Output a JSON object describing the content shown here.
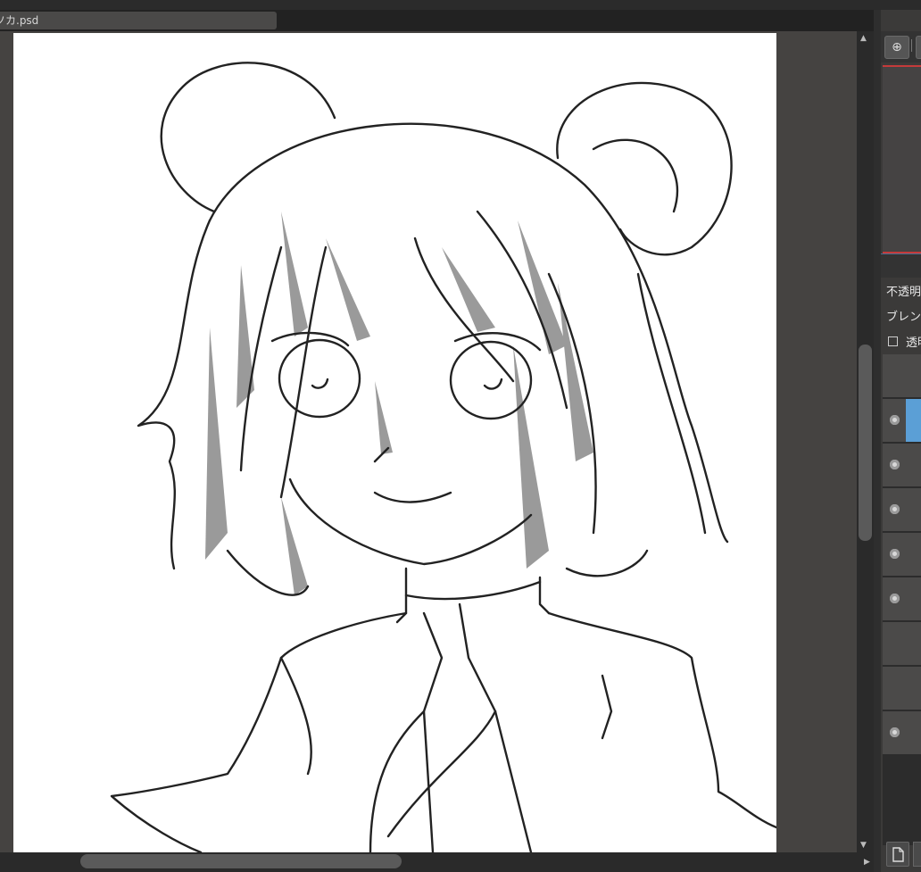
{
  "document": {
    "tab_title": "ソカ.psd"
  },
  "navigator": {
    "zoom_icon": "zoom-in-icon"
  },
  "layer_panel": {
    "opacity_label": "不透明",
    "blend_label": "ブレンド",
    "protect_alpha_label": "透明",
    "layers": [
      {
        "visible": false,
        "selected": false
      },
      {
        "visible": true,
        "selected": true
      },
      {
        "visible": true,
        "selected": false
      },
      {
        "visible": true,
        "selected": false
      },
      {
        "visible": true,
        "selected": false
      },
      {
        "visible": true,
        "selected": false
      },
      {
        "visible": false,
        "selected": false
      },
      {
        "visible": false,
        "selected": false
      },
      {
        "visible": true,
        "selected": false
      }
    ]
  },
  "colors": {
    "selection": "#5b9fd6",
    "navigator_frame": "#c43a3a",
    "canvas": "#ffffff",
    "workspace": "#454341"
  }
}
